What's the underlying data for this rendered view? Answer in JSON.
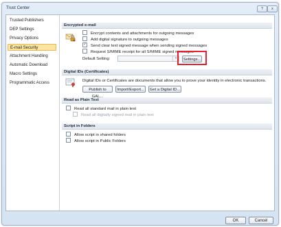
{
  "window": {
    "title": "Trust Center",
    "help_icon": "?",
    "close_icon": "x"
  },
  "nav": {
    "items": [
      {
        "label": "Trusted Publishers",
        "selected": false
      },
      {
        "label": "DEP Settings",
        "selected": false
      },
      {
        "label": "Privacy Options",
        "selected": false
      },
      {
        "label": "E-mail Security",
        "selected": true
      },
      {
        "label": "Attachment Handling",
        "selected": false
      },
      {
        "label": "Automatic Download",
        "selected": false
      },
      {
        "label": "Macro Settings",
        "selected": false
      },
      {
        "label": "Programmatic Access",
        "selected": false
      }
    ]
  },
  "encrypted": {
    "header": "Encrypted e-mail",
    "options": [
      {
        "label": "Encrypt contents and attachments for outgoing messages",
        "checked": false
      },
      {
        "label": "Add digital signature to outgoing messages",
        "checked": false
      },
      {
        "label": "Send clear text signed message when sending signed messages",
        "checked": true
      },
      {
        "label": "Request S/MIME receipt for all S/MIME signed messages",
        "checked": false
      }
    ],
    "default_setting_label": "Default Setting:",
    "default_setting_value": "",
    "settings_button": "Settings..."
  },
  "digital_ids": {
    "header": "Digital IDs (Certificates)",
    "description": "Digital IDs or Certificates are documents that allow you to prove your identity in electronic transactions.",
    "publish_button": "Publish to GAL...",
    "import_button": "Import/Export...",
    "get_id_button": "Get a Digital ID..."
  },
  "plain_text": {
    "header": "Read as Plain Text",
    "options": [
      {
        "label": "Read all standard mail in plain text",
        "checked": false
      },
      {
        "label": "Read all digitally signed mail in plain text",
        "checked": false,
        "disabled": true
      }
    ]
  },
  "script": {
    "header": "Script in Folders",
    "options": [
      {
        "label": "Allow script in shared folders",
        "checked": false
      },
      {
        "label": "Allow script in Public Folders",
        "checked": false
      }
    ]
  },
  "footer": {
    "ok": "OK",
    "cancel": "Cancel"
  },
  "colors": {
    "highlight": "#e6202e",
    "selected_nav": "#fce5a3"
  }
}
